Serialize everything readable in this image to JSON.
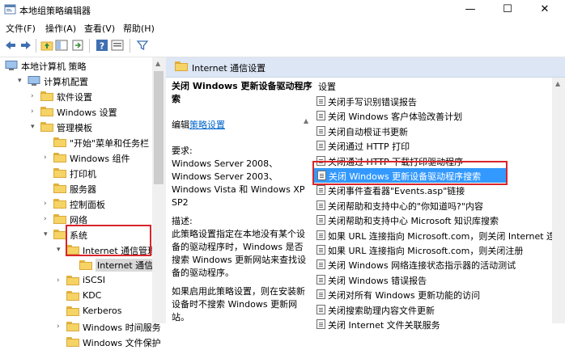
{
  "window": {
    "title": "本地组策略编辑器",
    "minimize": "—",
    "maximize": "☐",
    "close": "✕"
  },
  "menu": [
    "文件(F)",
    "操作(A)",
    "查看(V)",
    "帮助(H)"
  ],
  "tree": {
    "items": [
      {
        "label": "本地计算机 策略",
        "level": 0,
        "arrow": "",
        "icon": "computer-icon"
      },
      {
        "label": "计算机配置",
        "level": 1,
        "arrow": "▾",
        "icon": "computer-icon"
      },
      {
        "label": "软件设置",
        "level": 2,
        "arrow": "›",
        "icon": "folder-icon"
      },
      {
        "label": "Windows 设置",
        "level": 2,
        "arrow": "›",
        "icon": "folder-icon"
      },
      {
        "label": "管理模板",
        "level": 2,
        "arrow": "▾",
        "icon": "folder-icon"
      },
      {
        "label": "\"开始\"菜单和任务栏",
        "level": 3,
        "arrow": "",
        "icon": "folder-icon"
      },
      {
        "label": "Windows 组件",
        "level": 3,
        "arrow": "›",
        "icon": "folder-icon"
      },
      {
        "label": "打印机",
        "level": 3,
        "arrow": "",
        "icon": "folder-icon"
      },
      {
        "label": "服务器",
        "level": 3,
        "arrow": "",
        "icon": "folder-icon"
      },
      {
        "label": "控制面板",
        "level": 3,
        "arrow": "›",
        "icon": "folder-icon"
      },
      {
        "label": "网络",
        "level": 3,
        "arrow": "›",
        "icon": "folder-icon"
      },
      {
        "label": "系统",
        "level": 3,
        "arrow": "▾",
        "icon": "folder-icon"
      },
      {
        "label": "Internet 通信管理",
        "level": 4,
        "arrow": "▾",
        "icon": "folder-icon"
      },
      {
        "label": "Internet 通信设置",
        "level": 5,
        "arrow": "",
        "icon": "folder-icon",
        "selected": true
      },
      {
        "label": "iSCSI",
        "level": 4,
        "arrow": "›",
        "icon": "folder-icon"
      },
      {
        "label": "KDC",
        "level": 4,
        "arrow": "",
        "icon": "folder-icon"
      },
      {
        "label": "Kerberos",
        "level": 4,
        "arrow": "",
        "icon": "folder-icon"
      },
      {
        "label": "Windows 时间服务",
        "level": 4,
        "arrow": "›",
        "icon": "folder-icon"
      },
      {
        "label": "Windows 文件保护",
        "level": 4,
        "arrow": "",
        "icon": "folder-icon"
      }
    ]
  },
  "right_header": {
    "title": "Internet 通信设置"
  },
  "extended": {
    "policy_title_line1": "关闭 Windows 更新设备驱动程序搜",
    "policy_title_line2": "索",
    "edit_prefix": "编辑",
    "edit_link": "策略设置",
    "requirements_label": "要求:",
    "requirements": [
      "Windows Server 2008、",
      "Windows Server 2003、",
      "Windows Vista 和 Windows XP",
      "SP2"
    ],
    "description_label": "描述:",
    "description": [
      "此策略设置指定在本地没有某个设",
      "备的驱动程序时，Windows 是否",
      "搜索 Windows 更新网站来查找设",
      "备的驱动程序。"
    ],
    "description2": [
      "如果启用此策略设置，则在安装新",
      "设备时不搜索 Windows 更新网",
      "站。"
    ]
  },
  "settings": {
    "column_header": "设置",
    "items": [
      "关闭手写识别错误报告",
      "关闭 Windows 客户体验改善计划",
      "关闭自动根证书更新",
      "关闭通过 HTTP 打印",
      "关闭通过 HTTP 下载打印驱动程序",
      "关闭 Windows 更新设备驱动程序搜索",
      "关闭事件查看器\"Events.asp\"链接",
      "关闭帮助和支持中心的\"你知道吗?\"内容",
      "关闭帮助和支持中心 Microsoft 知识库搜索",
      "如果 URL 连接指向 Microsoft.com，则关闭 Internet 连接...",
      "如果 URL 连接指向 Microsoft.com，则关闭注册",
      "关闭 Windows 网络连接状态指示器的活动测试",
      "关闭 Windows 错误报告",
      "关闭对所有 Windows 更新功能的访问",
      "关闭搜索助理内容文件更新",
      "关闭 Internet 文件关联服务"
    ],
    "selected_index": 5
  },
  "colors": {
    "selection": "#3399ff",
    "highlight_box": "#d9252a",
    "header": "#dce6f4",
    "link": "#0066cc"
  }
}
